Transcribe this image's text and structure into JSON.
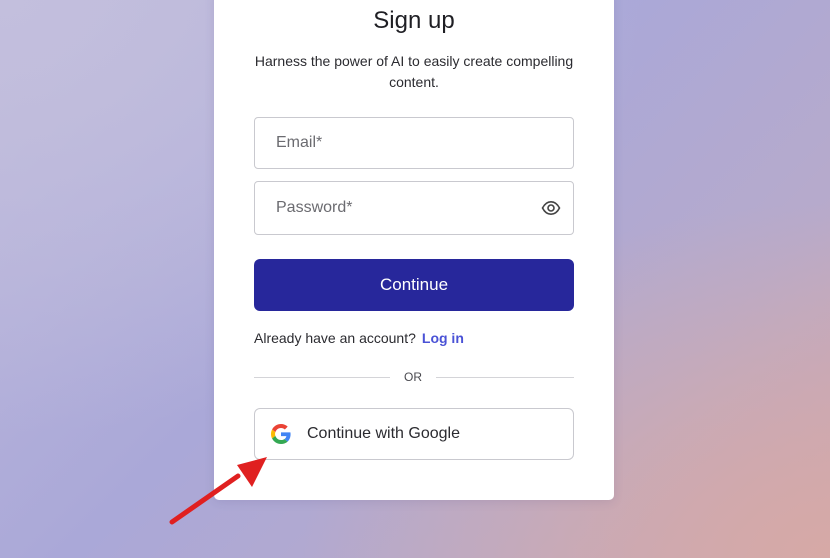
{
  "signup": {
    "title": "Sign up",
    "subtitle": "Harness the power of AI to easily create compelling content.",
    "email_placeholder": "Email*",
    "password_placeholder": "Password*",
    "continue_label": "Continue",
    "login_prompt": "Already have an account?",
    "login_link": "Log in",
    "divider": "OR",
    "google_label": "Continue with Google"
  },
  "icons": {
    "password_toggle": "eye-icon",
    "google": "google-g-logo",
    "annotation": "red-arrow"
  },
  "colors": {
    "primary_button": "#27279b",
    "link": "#4a52d6",
    "annotation_arrow": "#e02020"
  }
}
